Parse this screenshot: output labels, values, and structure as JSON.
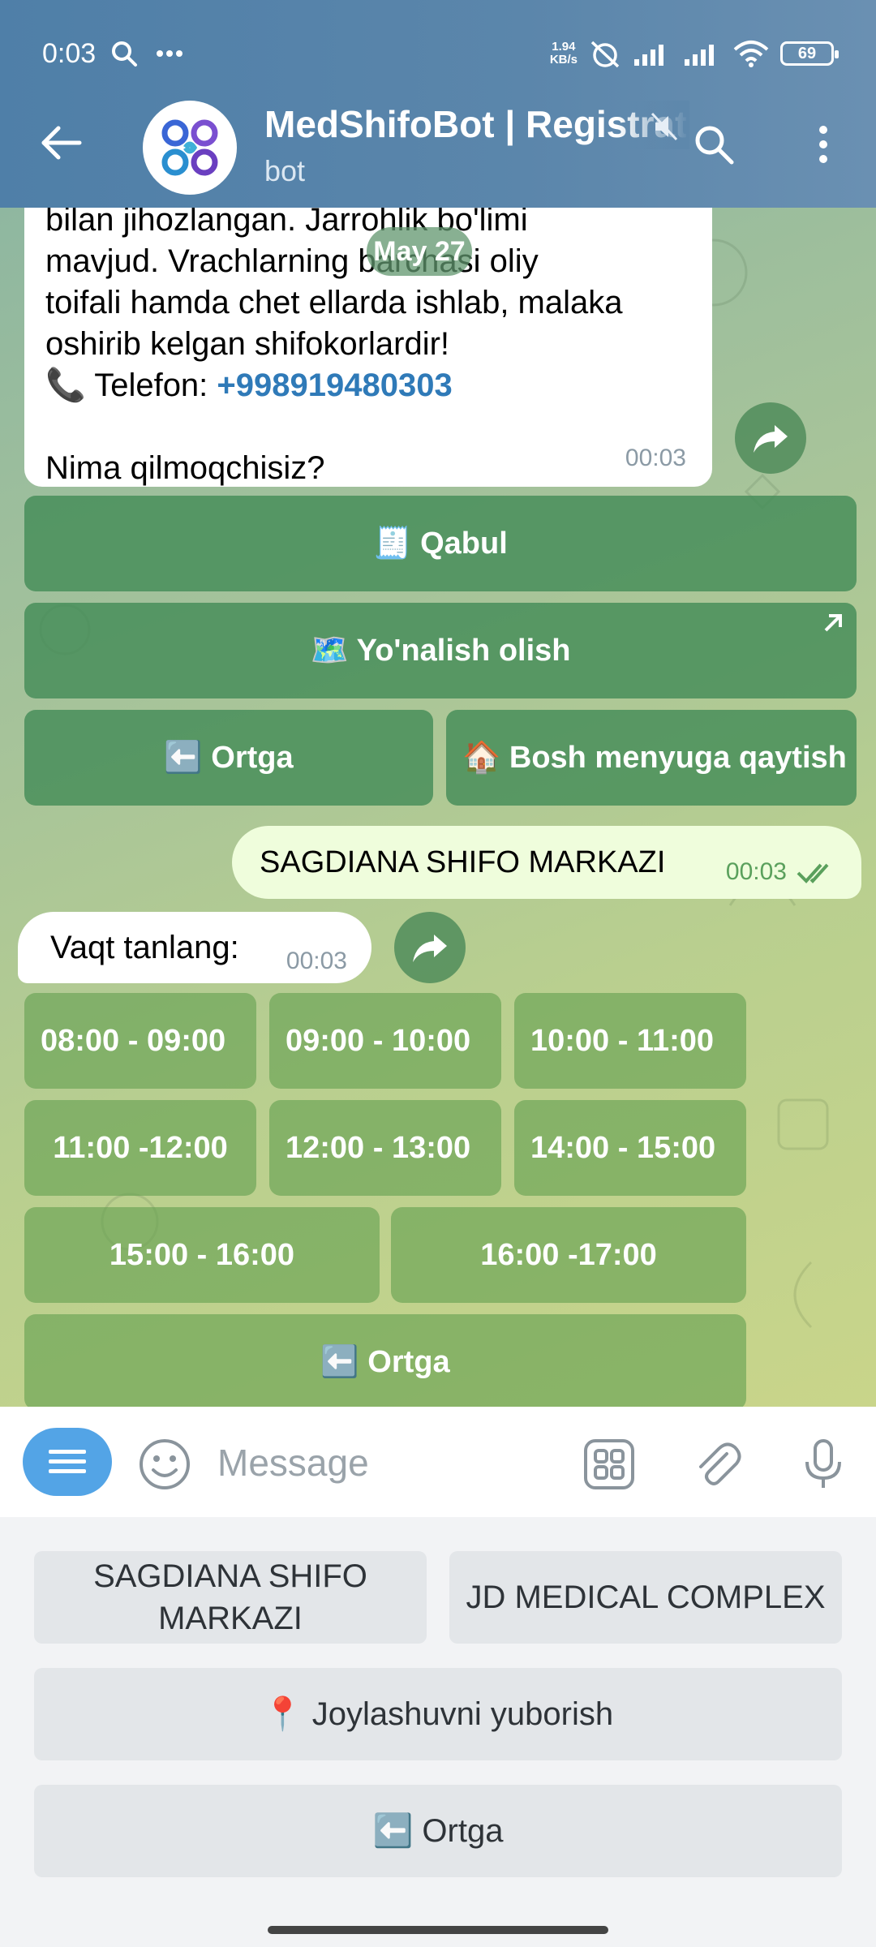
{
  "status_bar": {
    "time": "0:03",
    "network_speed_value": "1.94",
    "network_speed_unit": "KB/s",
    "battery": "69"
  },
  "header": {
    "title": "MedShifoBot | Registration",
    "subtitle": "bot"
  },
  "messages": {
    "bot_message_1": {
      "lines": [
        "bilan jihozlangan. Jarrohlik bo'limi",
        "mavjud. Vrachlarning barchasi oliy",
        "toifali  hamda chet ellarda ishlab, malaka",
        "oshirib kelgan shifokorlardir!"
      ],
      "phone_label": "📞 Telefon: ",
      "phone_number": "+998919480303",
      "question": "Nima qilmoqchisiz?",
      "time": "00:03"
    },
    "date_pill": "May 27",
    "inline_keyboard_1": {
      "qabul": "🧾 Qabul",
      "yonalish": "🗺️ Yo'nalish olish",
      "ortga": "⬅️ Ortga",
      "bosh_menyu": "🏠 Bosh menyuga qaytish"
    },
    "user_message": {
      "text": "SAGDIANA SHIFO MARKAZI",
      "time": "00:03"
    },
    "bot_message_2": {
      "text": "Vaqt tanlang:",
      "time": "00:03"
    },
    "time_slots": [
      "08:00 - 09:00",
      "09:00 - 10:00",
      "10:00 - 11:00",
      "11:00 -12:00",
      "12:00 - 13:00",
      "14:00 - 15:00",
      "15:00 - 16:00",
      "16:00 -17:00"
    ],
    "time_slots_back": "⬅️ Ortga"
  },
  "input": {
    "placeholder": "Message"
  },
  "reply_keyboard": {
    "option_1": "SAGDIANA SHIFO MARKAZI",
    "option_2": "JD MEDICAL COMPLEX",
    "send_location": "📍 Joylashuvni yuborish",
    "back": "⬅️ Ortga"
  },
  "colors": {
    "header": "#5b86ab",
    "accent": "#53a4e6",
    "keyboard_button": "#448c58",
    "outgoing_bubble": "#effddc",
    "link": "#2f7ab8"
  }
}
